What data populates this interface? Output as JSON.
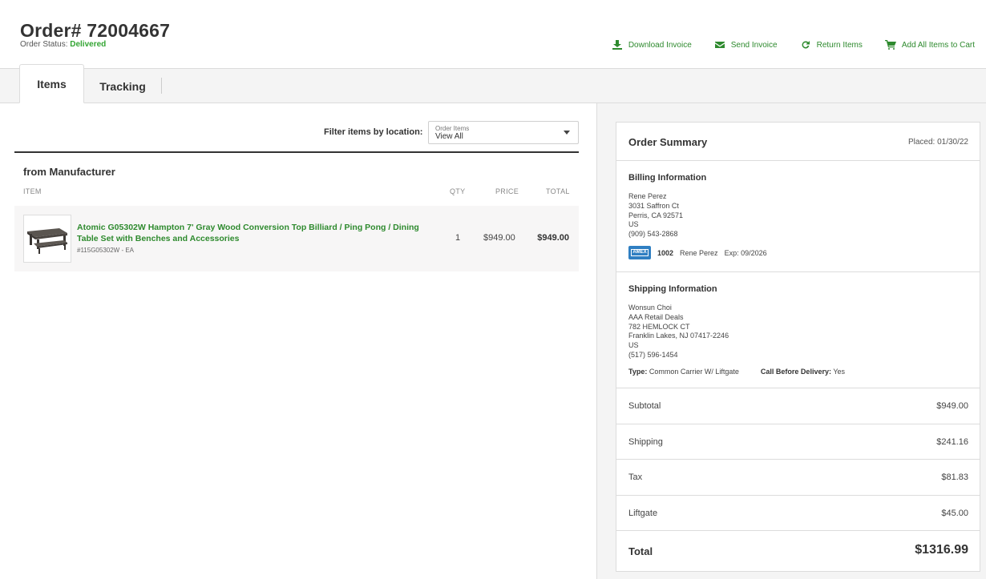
{
  "header": {
    "order_title": "Order# 72004667",
    "status_label": "Order Status:",
    "status_value": "Delivered"
  },
  "actions": [
    {
      "label": "Download Invoice",
      "icon": "download-icon"
    },
    {
      "label": "Send Invoice",
      "icon": "envelope-icon"
    },
    {
      "label": "Return Items",
      "icon": "refresh-icon"
    },
    {
      "label": "Add All Items to Cart",
      "icon": "cart-icon"
    }
  ],
  "tabs": [
    {
      "label": "Items",
      "active": true
    },
    {
      "label": "Tracking",
      "active": false
    }
  ],
  "filter": {
    "label": "Filter items by location:",
    "select_caption": "Order Items",
    "select_value": "View All"
  },
  "items_section": {
    "title": "from Manufacturer",
    "columns": {
      "item": "ITEM",
      "qty": "QTY",
      "price": "PRICE",
      "total": "TOTAL"
    },
    "rows": [
      {
        "name": "Atomic G05302W Hampton 7' Gray Wood Conversion Top Billiard / Ping Pong / Dining Table Set with Benches and Accessories",
        "sku": "#115G05302W - EA",
        "qty": "1",
        "price": "$949.00",
        "total": "$949.00",
        "thumbnail": "table-thumbnail"
      }
    ]
  },
  "summary": {
    "title": "Order Summary",
    "placed": "Placed: 01/30/22",
    "billing": {
      "title": "Billing Information",
      "lines": [
        "Rene Perez",
        "3031 Saffron Ct",
        "Perris, CA 92571",
        "US",
        "(909) 543-2868"
      ],
      "card_brand": "AMEX",
      "card_last4": "1002",
      "card_name": "Rene Perez",
      "card_exp": "Exp: 09/2026"
    },
    "shipping": {
      "title": "Shipping Information",
      "lines": [
        "Wonsun Choi",
        "AAA Retail Deals",
        "782 HEMLOCK CT",
        "Franklin Lakes, NJ 07417-2246",
        "US",
        "(517) 596-1454"
      ],
      "type_label": "Type:",
      "type_value": "Common Carrier W/ Liftgate",
      "call_label": "Call Before Delivery:",
      "call_value": "Yes"
    },
    "rows": [
      {
        "label": "Subtotal",
        "value": "$949.00"
      },
      {
        "label": "Shipping",
        "value": "$241.16"
      },
      {
        "label": "Tax",
        "value": "$81.83"
      },
      {
        "label": "Liftgate",
        "value": "$45.00"
      }
    ],
    "total": {
      "label": "Total",
      "value": "$1316.99"
    }
  },
  "colors": {
    "accent": "#2e8a2e",
    "status": "#33a533",
    "amex": "#2f7fc2"
  }
}
